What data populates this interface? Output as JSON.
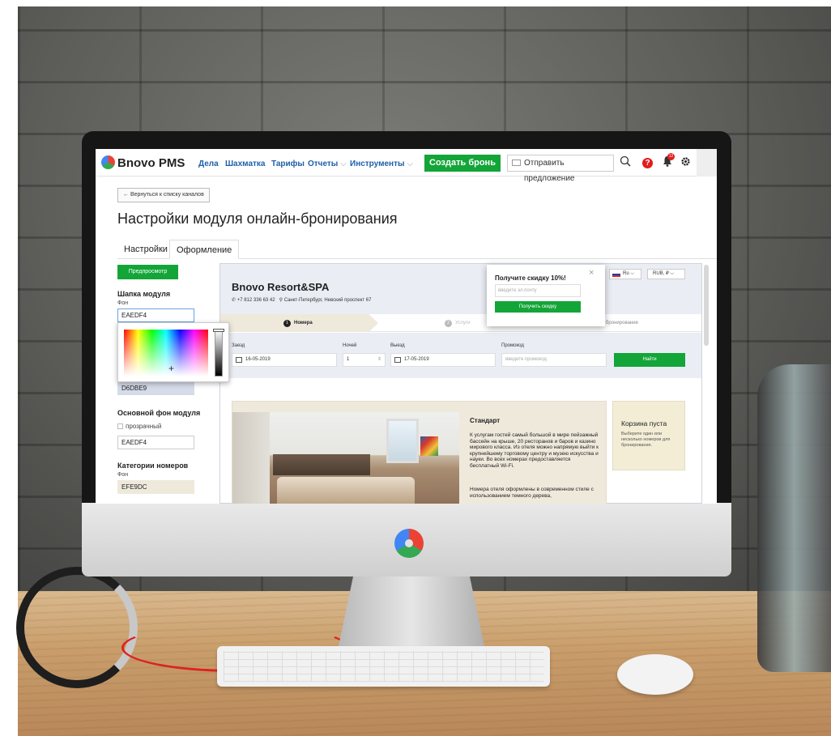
{
  "app": {
    "brand": "Bnovo PMS",
    "nav": [
      {
        "label": "Дела",
        "caret": ""
      },
      {
        "label": "Шахматка",
        "caret": ""
      },
      {
        "label": "Тарифы",
        "caret": ""
      },
      {
        "label": "Отчеты",
        "caret": "⌵"
      },
      {
        "label": "Инструменты",
        "caret": "⌵"
      }
    ],
    "create_booking": "Создать бронь",
    "send_offer": "Отправить предложение",
    "notifications_count": "12",
    "help_label": "?"
  },
  "page": {
    "back_button": "← Вернуться к списку каналов",
    "title": "Настройки модуля онлайн-бронирования",
    "tabs": [
      "Настройки",
      "Оформление"
    ],
    "active_tab": "Оформление"
  },
  "settings": {
    "preview_button": "Предпросмотр",
    "header_section": "Шапка модуля",
    "bg_label": "Фон",
    "header_bg_value": "EAEDF4",
    "extra_value": "D6DBE9",
    "main_bg_section": "Основной фон модуля",
    "transparent_label": "прозрачный",
    "main_bg_value": "EAEDF4",
    "categories_section": "Категории номеров",
    "categories_bg_label": "Фон",
    "categories_bg_value": "EFE9DC"
  },
  "preview": {
    "hotel_name": "Bnovo Resort&SPA",
    "phone": "+7 812 336 63 42",
    "address": "Санкт-Петербург, Невский проспект 67",
    "language": "Ru",
    "currency": "RUB, ₽",
    "steps": [
      {
        "num": "1",
        "label": "Номера"
      },
      {
        "num": "2",
        "label": "Услуги"
      },
      {
        "num": "",
        "label": "бронирование"
      }
    ],
    "search": {
      "checkin_label": "Заезд",
      "checkin_value": "16-05-2019",
      "nights_label": "Ночей",
      "nights_value": "1",
      "checkout_label": "Выезд",
      "checkout_value": "17-05-2019",
      "promo_label": "Промокод",
      "promo_placeholder": "введите промокод",
      "find_button": "Найти"
    },
    "room": {
      "title": "Стандарт",
      "description": "К услугам гостей самый большой в мире пейзажный бассейн на крыше, 20 ресторанов и баров и казино мирового класса. Из отеля можно напрямую выйти к крупнейшему торговому центру и музею искусства и науки. Во всех номерах предоставляется бесплатный Wi-Fi.",
      "description2": "Номера отеля оформлены в современном стиле с использованием темного дерева,"
    },
    "cart": {
      "title": "Корзина пуста",
      "description": "Выберите один или несколько номеров для бронирования."
    },
    "popup": {
      "title": "Получите скидку 10%!",
      "email_placeholder": "введите эл.почту",
      "button": "Получить скидку",
      "close": "×"
    }
  },
  "colors": {
    "accent_green": "#13a538",
    "nav_link": "#1e5fa8",
    "header_bg": "#eaedf4",
    "category_bg": "#efe9dc",
    "badge_red": "#e01d1d"
  },
  "icons": [
    "search-icon",
    "help-icon",
    "notification-icon",
    "gear-icon",
    "mail-icon",
    "phone-icon",
    "location-icon",
    "calendar-icon",
    "close-icon"
  ]
}
